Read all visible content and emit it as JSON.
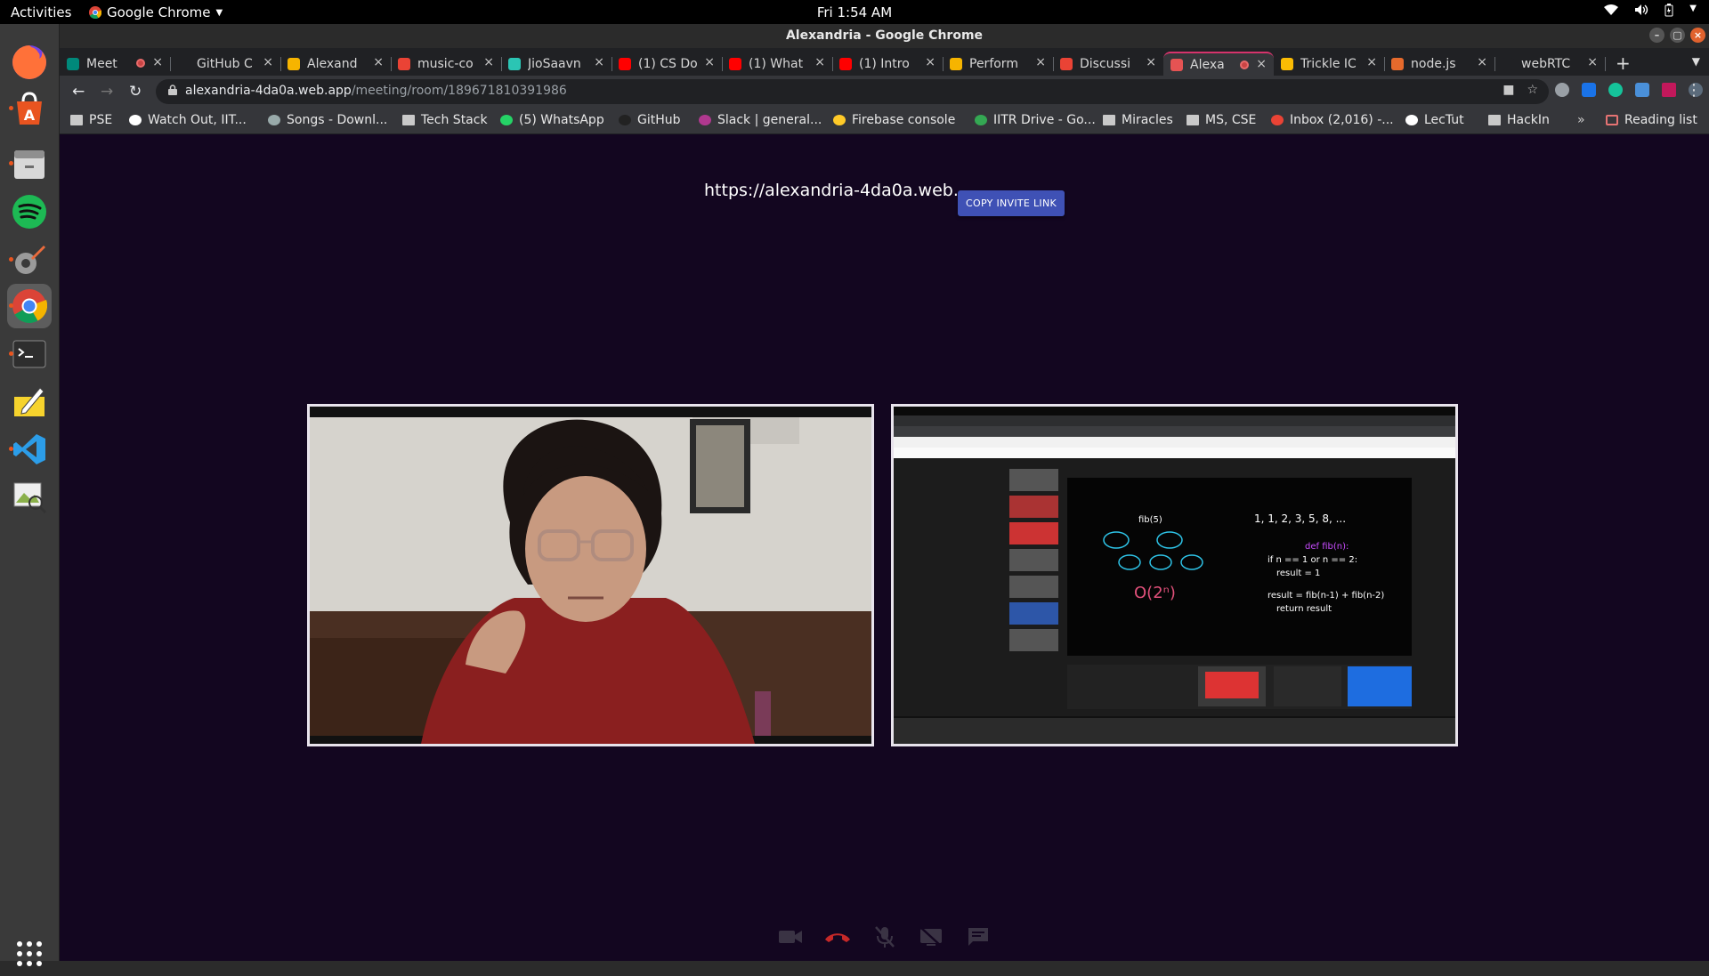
{
  "topbar": {
    "activities": "Activities",
    "app_name": "Google Chrome",
    "clock": "Fri  1:54 AM"
  },
  "dock": {
    "items": [
      {
        "name": "firefox-icon",
        "color": "#ff7139"
      },
      {
        "name": "software-center-icon",
        "color": "#e95420"
      },
      {
        "name": "files-icon",
        "color": "#d8d8d8"
      },
      {
        "name": "spotify-icon",
        "color": "#1db954"
      },
      {
        "name": "settings-tools-icon",
        "color": "#ea6b3c"
      },
      {
        "name": "chrome-icon",
        "color": "#4285f4"
      },
      {
        "name": "terminal-icon",
        "color": "#2e2e2e"
      },
      {
        "name": "text-editor-icon",
        "color": "#f6d32d"
      },
      {
        "name": "vscode-icon",
        "color": "#2c9de8"
      },
      {
        "name": "image-viewer-icon",
        "color": "#8ab04a"
      },
      {
        "name": "app-grid-icon",
        "color": "#ffffff"
      }
    ]
  },
  "window": {
    "title": "Alexandria - Google Chrome"
  },
  "tabs": [
    {
      "label": "Meet",
      "color": "#00897b",
      "recording": true
    },
    {
      "label": "GitHub C",
      "color": "#202124"
    },
    {
      "label": "Alexand",
      "color": "#f6b400"
    },
    {
      "label": "music-co",
      "color": "#ea4335"
    },
    {
      "label": "JioSaavn",
      "color": "#2bc5b4"
    },
    {
      "label": "(1) CS Do",
      "color": "#ff0000"
    },
    {
      "label": "(1) What",
      "color": "#ff0000"
    },
    {
      "label": "(1) Intro",
      "color": "#ff0000"
    },
    {
      "label": "Perform",
      "color": "#f6b400"
    },
    {
      "label": "Discussi",
      "color": "#ea4335"
    },
    {
      "label": "Alexa",
      "color": "#e55353",
      "recording": true,
      "active": true
    },
    {
      "label": "Trickle IC",
      "color": "#fbbc04"
    },
    {
      "label": "node.js",
      "color": "#e66a2c"
    },
    {
      "label": "webRTC",
      "color": "#202124"
    }
  ],
  "omnibox": {
    "host": "alexandria-4da0a.web.app",
    "path": "/meeting/room/189671810391986"
  },
  "bookmarks": [
    {
      "label": "PSE",
      "icon": "folder"
    },
    {
      "label": "Watch Out, IIT...",
      "icon": "page"
    },
    {
      "label": "Songs - Downl...",
      "icon": "music"
    },
    {
      "label": "Tech Stack",
      "icon": "folder"
    },
    {
      "label": "(5) WhatsApp",
      "icon": "whatsapp"
    },
    {
      "label": "GitHub",
      "icon": "github"
    },
    {
      "label": "Slack | general...",
      "icon": "slack"
    },
    {
      "label": "Firebase console",
      "icon": "firebase"
    },
    {
      "label": "IITR Drive - Go...",
      "icon": "drive"
    },
    {
      "label": "Miracles",
      "icon": "folder"
    },
    {
      "label": "MS, CSE",
      "icon": "folder"
    },
    {
      "label": "Inbox (2,016) -...",
      "icon": "gmail"
    },
    {
      "label": "LecTut",
      "icon": "send"
    },
    {
      "label": "HackIn",
      "icon": "folder"
    }
  ],
  "bookmarks_overflow": "»",
  "reading_list": "Reading list",
  "meeting": {
    "invite_url": "https://alexandria-4da0a.web.",
    "copy_button": "COPY INVITE LINK"
  },
  "controls": [
    {
      "name": "camera-icon",
      "color": "#3a3344"
    },
    {
      "name": "end-call-icon",
      "color": "#c62828"
    },
    {
      "name": "mic-off-icon",
      "color": "#3a3344"
    },
    {
      "name": "screen-share-off-icon",
      "color": "#3a3344"
    },
    {
      "name": "chat-icon",
      "color": "#3a3344"
    }
  ]
}
